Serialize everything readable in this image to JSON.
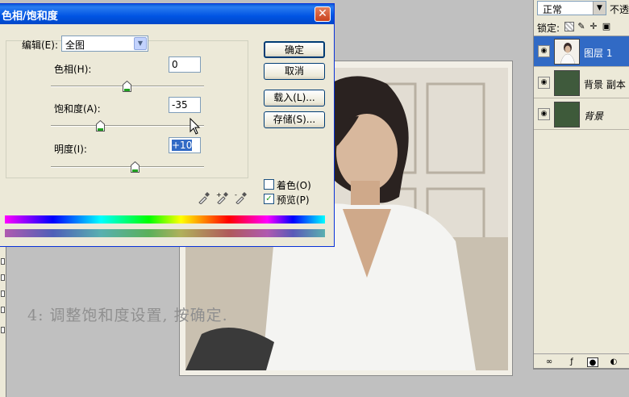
{
  "dialog": {
    "title": "色相/饱和度",
    "close_glyph": "✕",
    "edit_label": "编辑(E):",
    "edit_value": "全图",
    "hue": {
      "label": "色相(H):",
      "value": "0"
    },
    "saturation": {
      "label": "饱和度(A):",
      "value": "-35"
    },
    "lightness": {
      "label": "明度(I):",
      "value": "+10"
    },
    "buttons": {
      "ok": "确定",
      "cancel": "取消",
      "load": "载入(L)...",
      "save": "存储(S)..."
    },
    "colorize": {
      "label": "着色(O)",
      "checked": false
    },
    "preview": {
      "label": "预览(P)",
      "checked": true
    },
    "preview_check_glyph": "✓",
    "eyedropper_icons": [
      "eyedropper-icon",
      "eyedropper-plus-icon",
      "eyedropper-minus-icon"
    ]
  },
  "caption": "4: 调整饱和度设置, 按确定.",
  "layers_panel": {
    "blend_mode": "正常",
    "opacity_label": "不透",
    "lock_label": "锁定:",
    "lock_icons": [
      "transparency-lock-icon",
      "brush-lock-icon",
      "move-lock-icon",
      "padlock-icon"
    ],
    "layers": [
      {
        "name": "图层 1",
        "selected": true,
        "visible": true
      },
      {
        "name": "背景 副本",
        "selected": false,
        "visible": true
      },
      {
        "name": "背景",
        "selected": false,
        "visible": true
      }
    ],
    "footer_icons": [
      "link-icon",
      "layer-style-icon",
      "mask-icon",
      "adjustment-layer-icon"
    ]
  },
  "colors": {
    "titlebar": "#0054e3",
    "selected_layer": "#316ac5",
    "dialog_bg": "#ece9d8",
    "caption": "#8f8f8f"
  }
}
